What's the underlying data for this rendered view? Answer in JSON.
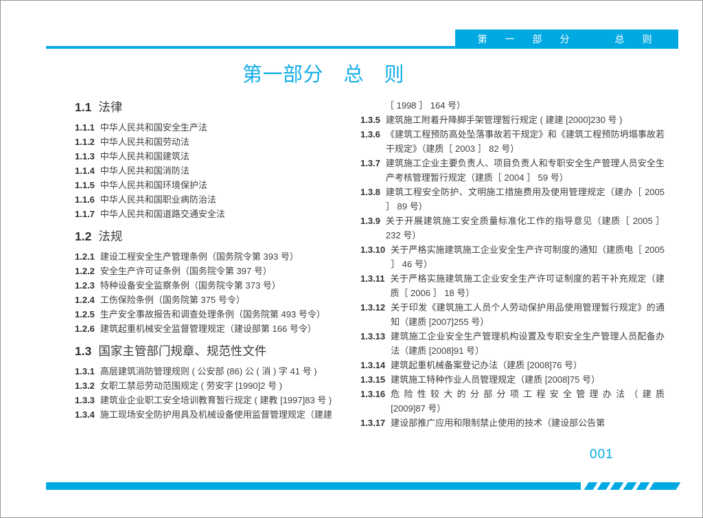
{
  "accent_color": "#00a9e2",
  "header": {
    "banner_text": "第　一　部　分　　　总　则",
    "title": "第一部分　总　则"
  },
  "footer": {
    "page_number": "001"
  },
  "toc": {
    "left": [
      {
        "type": "heading",
        "num": "1.1",
        "text": "法律"
      },
      {
        "type": "item",
        "num": "1.1.1",
        "text": "中华人民共和国安全生产法"
      },
      {
        "type": "item",
        "num": "1.1.2",
        "text": "中华人民共和国劳动法"
      },
      {
        "type": "item",
        "num": "1.1.3",
        "text": "中华人民共和国建筑法"
      },
      {
        "type": "item",
        "num": "1.1.4",
        "text": "中华人民共和国消防法"
      },
      {
        "type": "item",
        "num": "1.1.5",
        "text": "中华人民共和国环境保护法"
      },
      {
        "type": "item",
        "num": "1.1.6",
        "text": "中华人民共和国职业病防治法"
      },
      {
        "type": "item",
        "num": "1.1.7",
        "text": "中华人民共和国道路交通安全法"
      },
      {
        "type": "heading",
        "num": "1.2",
        "text": "法规"
      },
      {
        "type": "item",
        "num": "1.2.1",
        "text": "建设工程安全生产管理条例（国务院令第 393 号）"
      },
      {
        "type": "item",
        "num": "1.2.2",
        "text": "安全生产许可证条例（国务院令第 397 号）"
      },
      {
        "type": "item",
        "num": "1.2.3",
        "text": "特种设备安全监察条例（国务院令第 373 号）"
      },
      {
        "type": "item",
        "num": "1.2.4",
        "text": "工伤保险条例（国务院第 375 号令）"
      },
      {
        "type": "item",
        "num": "1.2.5",
        "text": "生产安全事故报告和调查处理条例（国务院第 493 号令）"
      },
      {
        "type": "item",
        "num": "1.2.6",
        "text": "建筑起重机械安全监督管理规定（建设部第 166 号令）"
      },
      {
        "type": "heading",
        "num": "1.3",
        "text": "国家主管部门规章、规范性文件"
      },
      {
        "type": "item",
        "num": "1.3.1",
        "text": "高层建筑消防管理规则 ( 公安部 (86) 公 ( 消 ) 字 41 号 )"
      },
      {
        "type": "item",
        "num": "1.3.2",
        "text": "女职工禁忌劳动范围规定 ( 劳安字 [1990]2 号 )"
      },
      {
        "type": "item",
        "num": "1.3.3",
        "text": "建筑业企业职工安全培训教育暂行规定 ( 建教 [1997]83 号 )"
      },
      {
        "type": "item",
        "num": "1.3.4",
        "text": "施工现场安全防护用具及机械设备使用监督管理规定（建建"
      }
    ],
    "right": [
      {
        "type": "continuation",
        "text": "［ 1998 ］ 164 号）"
      },
      {
        "type": "item",
        "num": "1.3.5",
        "text": "建筑施工附着升降脚手架管理暂行规定 ( 建建 [2000]230 号 )"
      },
      {
        "type": "item",
        "num": "1.3.6",
        "text": "《建筑工程预防高处坠落事故若干规定》和《建筑工程预防坍塌事故若干规定》（建质［ 2003 ］ 82 号）"
      },
      {
        "type": "item",
        "num": "1.3.7",
        "text": "建筑施工企业主要负责人、项目负责人和专职安全生产管理人员安全生产考核管理暂行规定（建质［ 2004 ］ 59 号）"
      },
      {
        "type": "item",
        "num": "1.3.8",
        "text": "建筑工程安全防护、文明施工措施费用及使用管理规定（建办［ 2005 ］ 89 号）"
      },
      {
        "type": "item",
        "num": "1.3.9",
        "text": "关于开展建筑施工安全质量标准化工作的指导意见（建质［ 2005 ］ 232 号）"
      },
      {
        "type": "item",
        "num": "1.3.10",
        "text": "关于严格实施建筑施工企业安全生产许可制度的通知（建质电［ 2005 ］ 46 号）"
      },
      {
        "type": "item",
        "num": "1.3.11",
        "text": "关于严格实施建筑施工企业安全生产许可证制度的若干补充规定（建质［ 2006 ］ 18 号）"
      },
      {
        "type": "item",
        "num": "1.3.12",
        "text": "关于印发《建筑施工人员个人劳动保护用品使用管理暂行规定》的通知（建质 [2007]255 号）"
      },
      {
        "type": "item",
        "num": "1.3.13",
        "text": "建筑施工企业安全生产管理机构设置及专职安全生产管理人员配备办法（建质 [2008]91 号）"
      },
      {
        "type": "item",
        "num": "1.3.14",
        "text": "建筑起重机械备案登记办法（建质 [2008]76 号）"
      },
      {
        "type": "item",
        "num": "1.3.15",
        "text": "建筑施工特种作业人员管理规定（建质 [2008]75 号）"
      },
      {
        "type": "item",
        "num": "1.3.16",
        "text": "危 险 性 较 大 的 分 部 分 项 工 程 安 全 管 理 办 法 （ 建 质 [2009]87 号）"
      },
      {
        "type": "item",
        "num": "1.3.17",
        "text": "建设部推广应用和限制禁止使用的技术（建设部公告第"
      }
    ]
  }
}
